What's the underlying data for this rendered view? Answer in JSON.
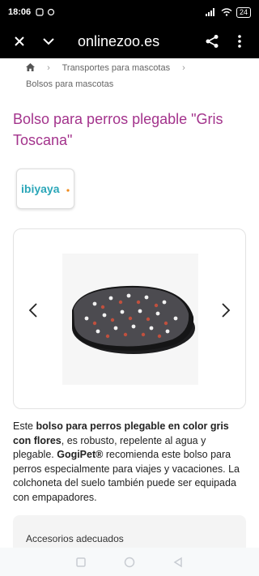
{
  "status": {
    "time": "18:06",
    "battery": "24"
  },
  "toolbar": {
    "url": "onlinezoo.es"
  },
  "breadcrumb": {
    "item1": "Transportes para mascotas",
    "item2": "Bolsos para mascotas"
  },
  "product": {
    "title": "Bolso para perros plegable \"Gris Toscana\""
  },
  "brand": {
    "logo_text": "ibiyaya"
  },
  "description": {
    "p1": "Este ",
    "b1": "bolso para perros plegable en color gris con flores",
    "p2": ", es robusto, repelente al agua y plegable. ",
    "b2": "GogiPet®",
    "p3": " recomienda este bolso para perros especialmente para viajes y vacaciones. La colchoneta del suelo también puede ser equipada con empapadores."
  },
  "accessories": {
    "label": "Accesorios adecuados"
  },
  "colors": {
    "title": "#a3338c",
    "brand_teal": "#2aa6b8",
    "brand_orange": "#f08a1c"
  }
}
